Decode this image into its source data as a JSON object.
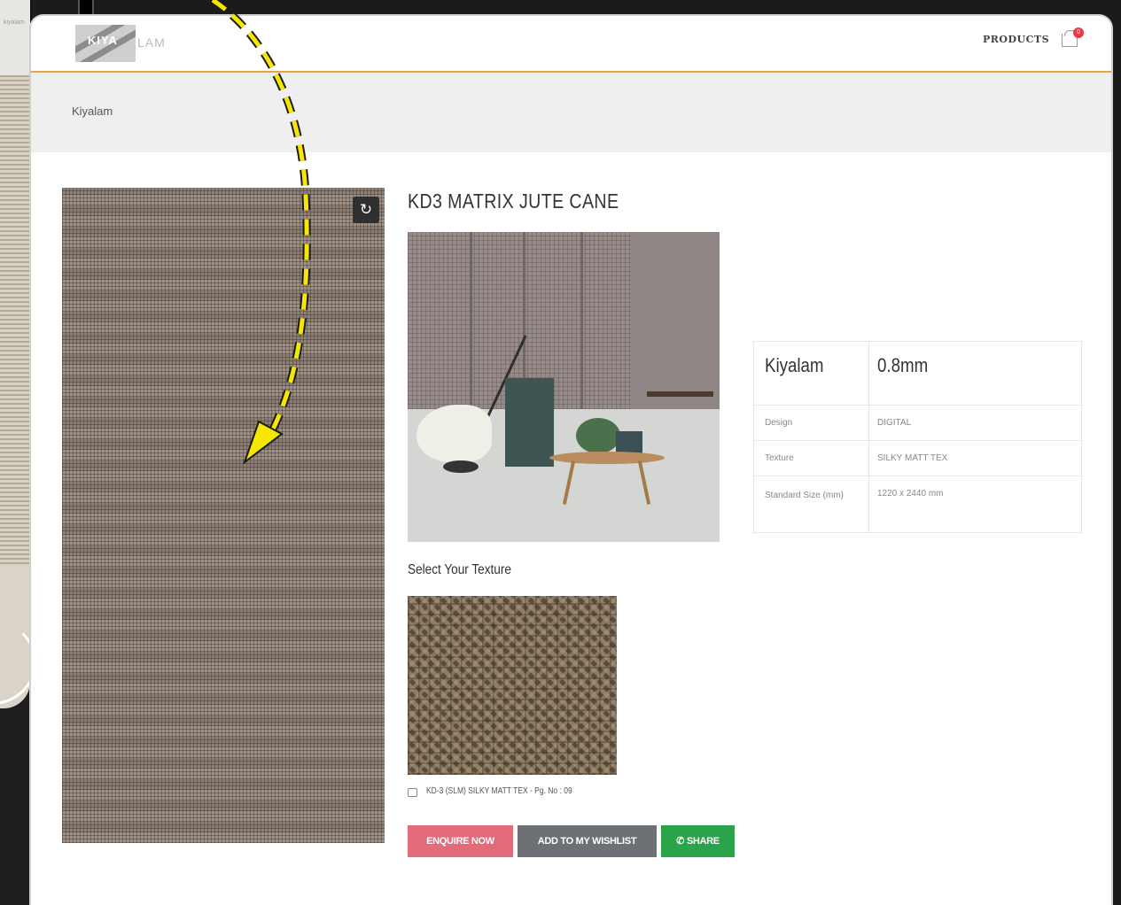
{
  "background_window": {
    "mini_logo": "kiyalam"
  },
  "header": {
    "logo_mark": "KIYA",
    "logo_rest": "LAM",
    "nav_products": "PRODUCTS",
    "cart_count": "0",
    "cart_icon": "cart-icon"
  },
  "breadcrumb": "Kiyalam",
  "product": {
    "title": "KD3 MATRIX JUTE CANE",
    "select_texture_label": "Select Your Texture",
    "texture_option": "KD-3 (SLM) SILKY MATT TEX - Pg. No : 09",
    "rotate_icon": "rotate-icon"
  },
  "spec_table": {
    "brand": "Kiyalam",
    "thickness": "0.8mm",
    "rows": [
      {
        "label": "Design",
        "value": "DIGITAL"
      },
      {
        "label": "Texture",
        "value": "SILKY MATT TEX"
      },
      {
        "label": "Standard Size (mm)",
        "value": "1220 x 2440 mm"
      }
    ]
  },
  "buttons": {
    "enquire": "ENQUIRE NOW",
    "wishlist": "ADD TO MY WISHLIST",
    "share": "SHARE",
    "share_icon": "whatsapp-icon"
  },
  "colors": {
    "accent": "#e9a43a",
    "enquire": "#e36a78",
    "wishlist": "#6d7175",
    "share": "#2aa34a",
    "annotation_arrow": "#f7e600"
  }
}
